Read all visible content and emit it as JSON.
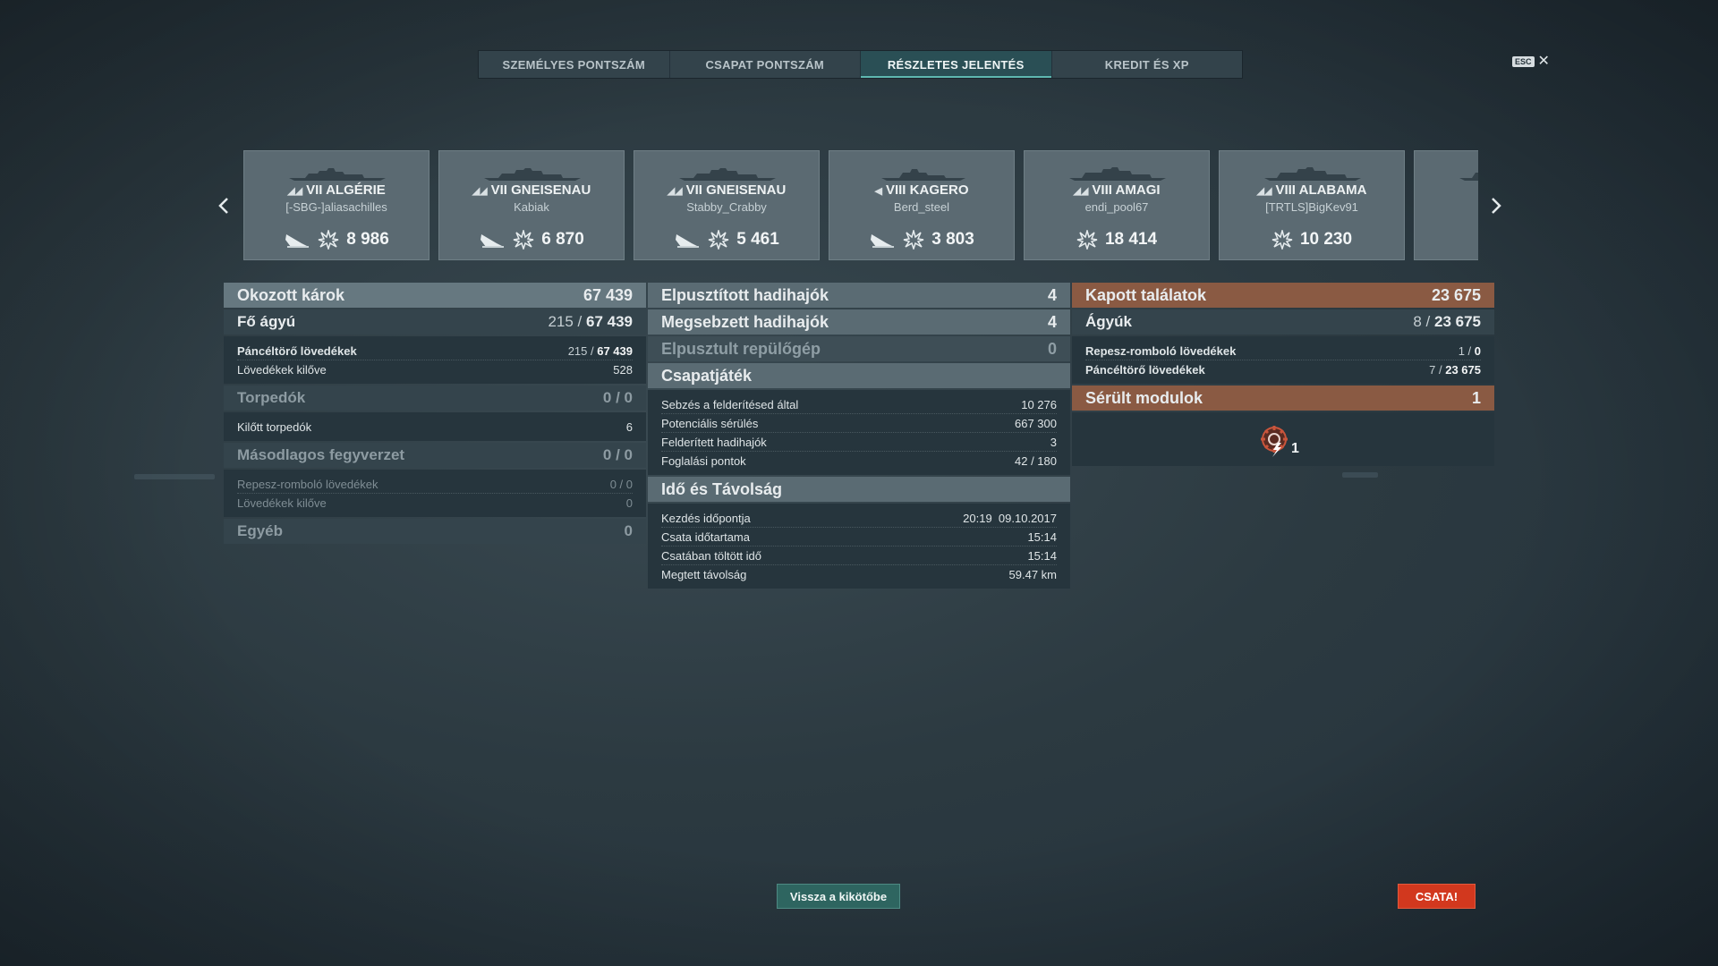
{
  "tabs": [
    {
      "label": "SZEMÉLYES PONTSZÁM",
      "active": false
    },
    {
      "label": "CSAPAT PONTSZÁM",
      "active": false
    },
    {
      "label": "RÉSZLETES JELENTÉS",
      "active": true
    },
    {
      "label": "KREDIT ÉS XP",
      "active": false
    }
  ],
  "esc": {
    "badge": "ESC",
    "close": "✕"
  },
  "carousel": {
    "prev": "‹",
    "next": "›",
    "ships": [
      {
        "tier": "VII",
        "name": "ALGÉRIE",
        "player": "[-SBG-]aliasachilles",
        "damage": "8 986",
        "sunk": true,
        "class_icon": "cruiser-icon"
      },
      {
        "tier": "VII",
        "name": "GNEISENAU",
        "player": "Kabiak",
        "damage": "6 870",
        "sunk": true,
        "class_icon": "cruiser-icon"
      },
      {
        "tier": "VII",
        "name": "GNEISENAU",
        "player": "Stabby_Crabby",
        "damage": "5 461",
        "sunk": true,
        "class_icon": "cruiser-icon"
      },
      {
        "tier": "VIII",
        "name": "KAGERO",
        "player": "Berd_steel",
        "damage": "3 803",
        "sunk": true,
        "class_icon": "destroyer-icon"
      },
      {
        "tier": "VIII",
        "name": "AMAGI",
        "player": "endi_pool67",
        "damage": "18 414",
        "sunk": false,
        "class_icon": "battleship-icon"
      },
      {
        "tier": "VIII",
        "name": "ALABAMA",
        "player": "[TRTLS]BigKev91",
        "damage": "10 230",
        "sunk": false,
        "class_icon": "battleship-icon"
      }
    ]
  },
  "damage_dealt": {
    "title": "Okozott károk",
    "total": "67 439",
    "main_guns": {
      "label": "Fő ágyú",
      "hits": "215",
      "damage": "67 439"
    },
    "main_rows": [
      {
        "label": "Páncéltörő lövedékek",
        "hits": "215",
        "damage": "67 439",
        "bold": true
      },
      {
        "label": "Lövedékek kilőve",
        "value": "528",
        "bold": false
      }
    ],
    "torpedoes": {
      "label": "Torpedók",
      "value": "0 / 0"
    },
    "torpedo_rows": [
      {
        "label": "Kilőtt torpedók",
        "value": "6"
      }
    ],
    "secondary": {
      "label": "Másodlagos fegyverzet",
      "value": "0 / 0"
    },
    "secondary_rows": [
      {
        "label": "Repesz-romboló lövedékek",
        "value": "0 / 0"
      },
      {
        "label": "Lövedékek kilőve",
        "value": "0"
      }
    ],
    "other": {
      "label": "Egyéb",
      "value": "0"
    }
  },
  "middle": {
    "destroyed": {
      "label": "Elpusztított hadihajók",
      "value": "4"
    },
    "damaged": {
      "label": "Megsebzett hadihajók",
      "value": "4"
    },
    "planes": {
      "label": "Elpusztult repülőgép",
      "value": "0"
    },
    "teamplay": {
      "title": "Csapatjáték",
      "rows": [
        {
          "label": "Sebzés a felderítésed által",
          "value": "10 276"
        },
        {
          "label": "Potenciális sérülés",
          "value": "667 300"
        },
        {
          "label": "Felderített hadihajók",
          "value": "3"
        },
        {
          "label": "Foglalási pontok",
          "value": "42 / 180"
        }
      ]
    },
    "time": {
      "title": "Idő és Távolság",
      "rows": [
        {
          "label": "Kezdés időpontja",
          "value": "20:19  09.10.2017"
        },
        {
          "label": "Csata időtartama",
          "value": "15:14"
        },
        {
          "label": "Csatában töltött idő",
          "value": "15:14"
        },
        {
          "label": "Megtett távolság",
          "value": "59.47 km"
        }
      ]
    }
  },
  "hits_received": {
    "title": "Kapott találatok",
    "total": "23 675",
    "guns": {
      "label": "Ágyúk",
      "hits": "8",
      "damage": "23 675"
    },
    "rows": [
      {
        "label": "Repesz-romboló lövedékek",
        "hits": "1",
        "damage": "0"
      },
      {
        "label": "Páncéltörő lövedékek",
        "hits": "7",
        "damage": "23 675"
      }
    ],
    "modules": {
      "label": "Sérült modulok",
      "value": "1",
      "module_count": "1",
      "module_icon": "engine-damage-icon"
    }
  },
  "buttons": {
    "port": "Vissza a kikötőbe",
    "battle": "CSATA!"
  },
  "colors": {
    "accent": "#2a4f55",
    "orange_header": "#8a5a43",
    "battle_button": "#d2381e"
  }
}
